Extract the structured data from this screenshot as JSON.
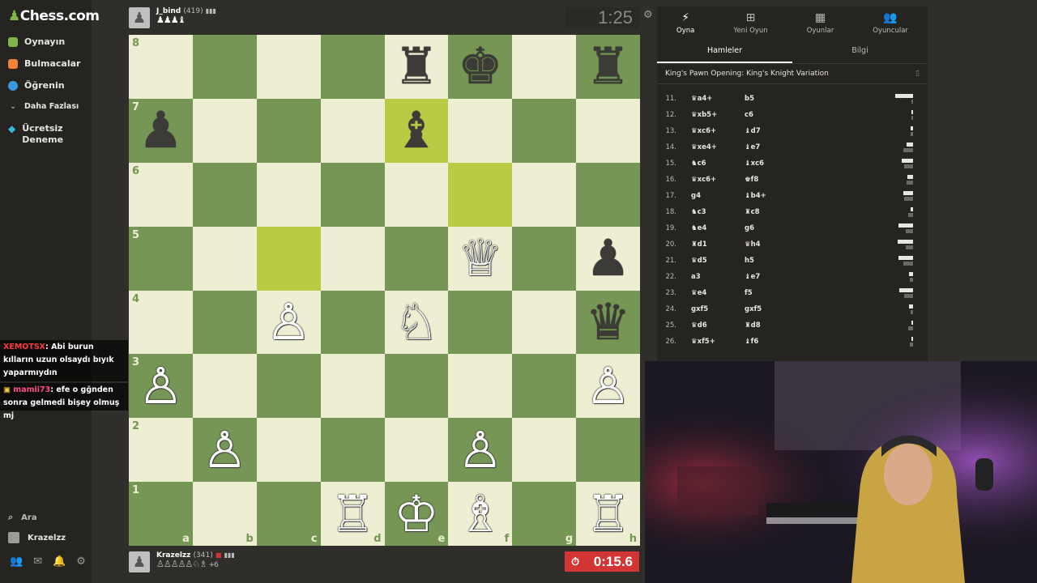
{
  "sidebar": {
    "logo": "Chess.com",
    "items": [
      {
        "label": "Oynayın",
        "icon": "play-icon",
        "color": "#81b64c"
      },
      {
        "label": "Bulmacalar",
        "icon": "puzzle-icon",
        "color": "#f5813a"
      },
      {
        "label": "Öğrenin",
        "icon": "learn-icon",
        "color": "#3a9ae0"
      },
      {
        "label": "Daha Fazlası",
        "icon": "chevron-down-icon",
        "color": "#bababa"
      }
    ],
    "trial": {
      "line1": "Ücretsiz",
      "line2": "Deneme",
      "icon": "diamond-icon"
    },
    "search_label": "Ara",
    "username": "Krazelzz"
  },
  "chat": [
    {
      "user": "XEMOTSX",
      "text": ": Abi burun kılların uzun olsaydı bıyık yaparmıydın"
    },
    {
      "user": "mamii73",
      "text": ": efe o gğnden sonra gelmedi bişey olmuş mj"
    }
  ],
  "top_player": {
    "name": "J_bind",
    "rating": "(419)",
    "captured": "♟♟♟♝",
    "clock": "1:25"
  },
  "bottom_player": {
    "name": "Krazelzz",
    "rating": "(341)",
    "captured": "♙♙♙♙♙♘♗",
    "advantage": "+6",
    "clock": "0:15.6"
  },
  "board": {
    "ranks": [
      "8",
      "7",
      "6",
      "5",
      "4",
      "3",
      "2",
      "1"
    ],
    "files": [
      "a",
      "b",
      "c",
      "d",
      "e",
      "f",
      "g",
      "h"
    ],
    "highlight_squares": [
      "e7",
      "f6",
      "c5"
    ],
    "pieces": {
      "e8": "♜",
      "f8": "♚",
      "h8": "♜",
      "a7": "♟",
      "e7": "♝",
      "f5": "♕",
      "h5": "♟",
      "c4": "♙",
      "e4": "♘",
      "h4": "♛",
      "a3": "♙",
      "h3": "♙",
      "b2": "♙",
      "f2": "♙",
      "d1": "♖",
      "e1": "♔",
      "f1": "♗",
      "h1": "♖"
    },
    "light_color": "#eeeed2",
    "dark_color": "#769656",
    "highlight_color": "#baca44"
  },
  "panel": {
    "tabs": [
      {
        "label": "Oyna",
        "icon": "lightning-icon"
      },
      {
        "label": "Yeni Oyun",
        "icon": "plus-icon"
      },
      {
        "label": "Oyunlar",
        "icon": "board-icon"
      },
      {
        "label": "Oyuncular",
        "icon": "users-icon"
      }
    ],
    "subtabs": [
      "Hamleler",
      "Bilgi"
    ],
    "opening": "King's Pawn Opening: King's Knight Variation",
    "moves": [
      {
        "n": "11.",
        "w": "♛a4+",
        "b": "b5",
        "t1": 24.4,
        "t2": 0.7
      },
      {
        "n": "12.",
        "w": "♛xb5+",
        "b": "c6",
        "t1": 2.7,
        "t2": 0.7
      },
      {
        "n": "13.",
        "w": "♛xc6+",
        "b": "♝d7",
        "t1": 3.0,
        "t2": 2.8
      },
      {
        "n": "14.",
        "w": "♛xe4+",
        "b": "♝e7",
        "t1": 8.6,
        "t2": 12.8
      },
      {
        "n": "15.",
        "w": "♞c6",
        "b": "♝xc6",
        "t1": 15.3,
        "t2": 12.2
      },
      {
        "n": "16.",
        "w": "♛xc6+",
        "b": "♚f8",
        "t1": 7.6,
        "t2": 8.8
      },
      {
        "n": "17.",
        "w": "g4",
        "b": "♝b4+",
        "t1": 13.4,
        "t2": 11.7
      },
      {
        "n": "18.",
        "w": "♞c3",
        "b": "♜c8",
        "t1": 3.0,
        "t2": 6.4
      },
      {
        "n": "19.",
        "w": "♞e4",
        "b": "g6",
        "t1": 19.6,
        "t2": 10.3
      },
      {
        "n": "20.",
        "w": "♜d1",
        "b": "♛h4",
        "t1": 20.6,
        "t2": 10.4
      },
      {
        "n": "21.",
        "w": "♛d5",
        "b": "h5",
        "t1": 19.9,
        "t2": 13.9
      },
      {
        "n": "22.",
        "w": "a3",
        "b": "♝e7",
        "t1": 5.5,
        "t2": 5.0
      },
      {
        "n": "23.",
        "w": "♛e4",
        "b": "f5",
        "t1": 18.7,
        "t2": 12.4
      },
      {
        "n": "24.",
        "w": "gxf5",
        "b": "gxf5",
        "t1": 6.1,
        "t2": 3.2
      },
      {
        "n": "25.",
        "w": "♛d6",
        "b": "♜d8",
        "t1": 0.6,
        "t2": 7.2
      },
      {
        "n": "26.",
        "w": "♛xf5+",
        "b": "♝f6",
        "t1": 1.2,
        "t2": 4.7
      }
    ]
  }
}
